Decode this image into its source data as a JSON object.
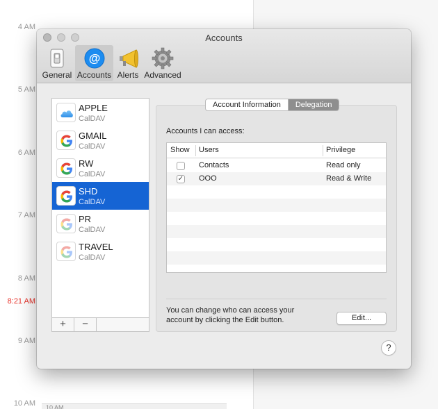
{
  "calendar": {
    "hours": [
      "4 AM",
      "5 AM",
      "6 AM",
      "7 AM",
      "8 AM",
      "9 AM",
      "10 AM"
    ],
    "current_time": "8:21 AM",
    "event_snippet": "10 AM",
    "now_color": "#e8322a"
  },
  "window": {
    "title": "Accounts"
  },
  "toolbar": {
    "items": [
      {
        "label": "General",
        "icon": "switch-icon"
      },
      {
        "label": "Accounts",
        "icon": "at-sign-icon"
      },
      {
        "label": "Alerts",
        "icon": "megaphone-icon"
      },
      {
        "label": "Advanced",
        "icon": "gear-icon"
      }
    ],
    "selected": "Accounts"
  },
  "accounts": [
    {
      "name": "APPLE",
      "type": "CalDAV",
      "icon": "icloud-icon"
    },
    {
      "name": "GMAIL",
      "type": "CalDAV",
      "icon": "google-icon"
    },
    {
      "name": "RW",
      "type": "CalDAV",
      "icon": "google-icon"
    },
    {
      "name": "SHD",
      "type": "CalDAV",
      "icon": "google-icon"
    },
    {
      "name": "PR",
      "type": "CalDAV",
      "icon": "google-icon"
    },
    {
      "name": "TRAVEL",
      "type": "CalDAV",
      "icon": "google-icon"
    }
  ],
  "selected_account": "SHD",
  "list_buttons": {
    "add": "+",
    "remove": "−"
  },
  "tabs": {
    "items": [
      "Account Information",
      "Delegation"
    ],
    "active": "Delegation"
  },
  "delegation": {
    "section_label": "Accounts I can access:",
    "columns": [
      "Show",
      "Users",
      "Privilege"
    ],
    "rows": [
      {
        "show": false,
        "user": "Contacts",
        "privilege": "Read only"
      },
      {
        "show": true,
        "user": "OOO",
        "privilege": "Read & Write"
      }
    ],
    "info_text": "You can change who can access your account by clicking the Edit button.",
    "edit_label": "Edit...",
    "help_label": "?"
  },
  "colors": {
    "selection": "#1564d4",
    "accounts_icon": "#1c8cf0",
    "google_blue": "#4285F4",
    "google_red": "#EA4335",
    "google_yellow": "#FBBC05",
    "google_green": "#34A853"
  }
}
